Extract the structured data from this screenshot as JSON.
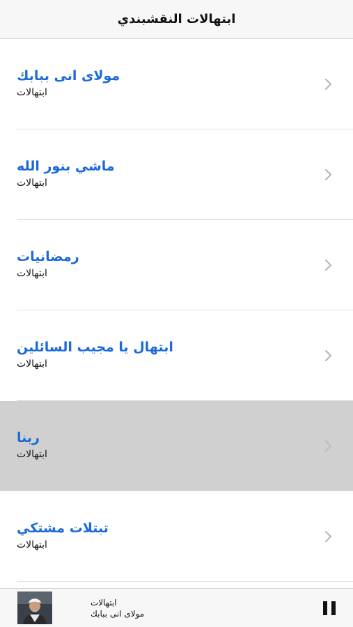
{
  "header": {
    "title": "ابتهالات النقشبندي"
  },
  "list": {
    "items": [
      {
        "title": "مولاى انى ببابك",
        "subtitle": "ابتهالات",
        "selected": false
      },
      {
        "title": "ماشي بنور الله",
        "subtitle": "ابتهالات",
        "selected": false
      },
      {
        "title": "رمضانيات",
        "subtitle": "ابتهالات",
        "selected": false
      },
      {
        "title": "ابتهال يا مجيب السائلين",
        "subtitle": "ابتهالات",
        "selected": false
      },
      {
        "title": "ربنا",
        "subtitle": "ابتهالات",
        "selected": true
      },
      {
        "title": "تبتلات مشتكي",
        "subtitle": "ابتهالات",
        "selected": false
      }
    ]
  },
  "player": {
    "category": "ابتهالات",
    "track": "مولاى انى ببابك",
    "state_icon": "pause-icon"
  },
  "colors": {
    "title_blue": "#1b6ad8",
    "selected_row": "#d0d0d0",
    "bar_background": "#f7f7f7"
  }
}
